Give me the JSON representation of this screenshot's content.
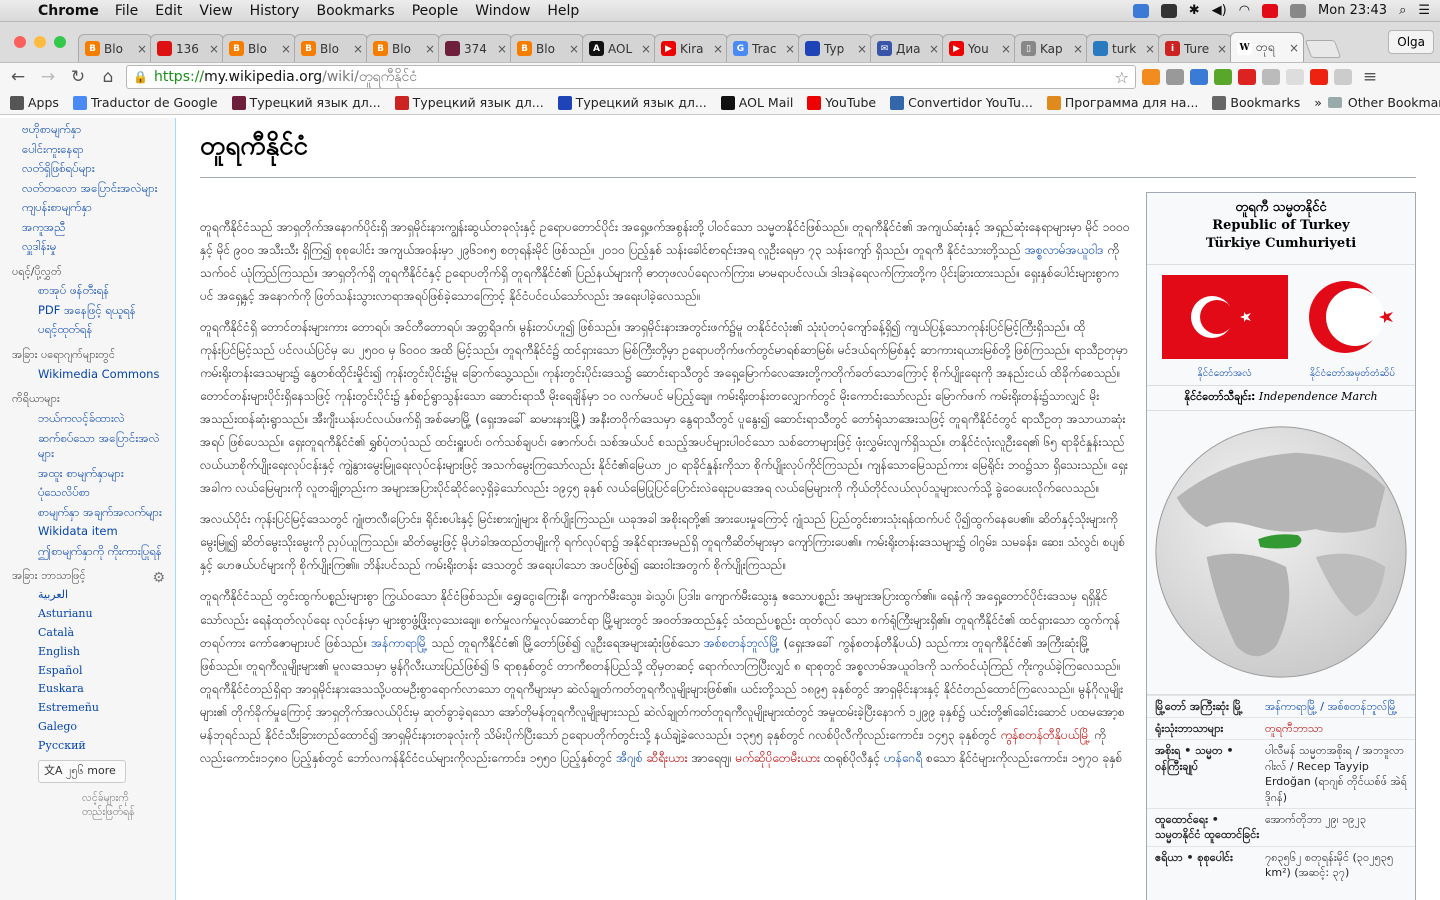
{
  "menubar": {
    "app": "Chrome",
    "items": [
      "File",
      "Edit",
      "View",
      "History",
      "Bookmarks",
      "People",
      "Window",
      "Help"
    ],
    "clock": "Mon 23:43"
  },
  "tabs": [
    {
      "title": "Blo",
      "color": "#f57d00",
      "glyph": "B"
    },
    {
      "title": "136",
      "color": "#d11",
      "glyph": ""
    },
    {
      "title": "Blo",
      "color": "#f57d00",
      "glyph": "B"
    },
    {
      "title": "Blo",
      "color": "#f57d00",
      "glyph": "B"
    },
    {
      "title": "Blo",
      "color": "#f57d00",
      "glyph": "B"
    },
    {
      "title": "374",
      "color": "#6d1f3b",
      "glyph": ""
    },
    {
      "title": "Blo",
      "color": "#f57d00",
      "glyph": "B"
    },
    {
      "title": "AOL",
      "color": "#111",
      "glyph": "A"
    },
    {
      "title": "Kira",
      "color": "#e00",
      "glyph": "▶"
    },
    {
      "title": "Trac",
      "color": "#4a8af4",
      "glyph": "G"
    },
    {
      "title": "Typ",
      "color": "#1e44b8",
      "glyph": ""
    },
    {
      "title": "Диа",
      "color": "#3a55a8",
      "glyph": "✉"
    },
    {
      "title": "You",
      "color": "#e00",
      "glyph": "▶"
    },
    {
      "title": "Kap",
      "color": "#888",
      "glyph": "▯"
    },
    {
      "title": "turk",
      "color": "#2a7ac0",
      "glyph": ""
    },
    {
      "title": "Ture",
      "color": "#c22",
      "glyph": "i"
    },
    {
      "title": "တုရ",
      "color": "#fff",
      "glyph": "W"
    }
  ],
  "profile_name": "Olga",
  "address": {
    "scheme": "https://",
    "host": "my.wikipedia.org",
    "path": "/wiki/တူရကီနိုင်ငံ"
  },
  "bookmarks": [
    {
      "label": "Apps",
      "color": "#555"
    },
    {
      "label": "Traductor de Google",
      "color": "#4a8af4"
    },
    {
      "label": "Турецкий язык дл...",
      "color": "#6d1f3b"
    },
    {
      "label": "Турецкий язык дл...",
      "color": "#c22"
    },
    {
      "label": "Турецкий язык дл...",
      "color": "#1e44b8"
    },
    {
      "label": "AOL Mail",
      "color": "#111"
    },
    {
      "label": "YouTube",
      "color": "#e00"
    },
    {
      "label": "Convertidor YouTu...",
      "color": "#3366aa"
    },
    {
      "label": "Программа для на...",
      "color": "#e08a1e"
    },
    {
      "label": "Bookmarks",
      "color": "#666"
    }
  ],
  "other_bookmarks": "Other Bookmarks",
  "sidebar": {
    "top_links": [
      "ဗဟိုစာမျက်နှာ",
      "ပေါင်းကူးနေရာ",
      "လတ်ရှိဖြစ်ရပ်များ",
      "လတ်တလော အပြောင်းအလဲများ",
      "ကျပန်းစာမျက်နှာ",
      "အကူအညီ",
      "လှူဒါန်းမှု"
    ],
    "print_heading": "ပရင့်/ပို့လွှတ်",
    "print_links": [
      "စာအုပ် ဖန်တီးရန်",
      "PDF အနေဖြင့် ရယူရန်",
      "ပရင့်ထုတ်ရန်"
    ],
    "projects_heading": "အခြား ပရောဂျက်များတွင်",
    "projects_links": [
      "Wikimedia Commons"
    ],
    "tools_heading": "ကိရိယာများ",
    "tools_links": [
      "ဘယ်ကလင့်ခ်ထားလဲ",
      "ဆက်စပ်သော အပြောင်းအလဲများ",
      "အထူး စာမျက်နှာများ",
      "ပုံသေလိပ်စာ",
      "စာမျက်နှာ အချက်အလက်များ",
      "Wikidata item",
      "ဤစာမျက်နှာကို ကိုးကားပြုရန်"
    ],
    "lang_heading": "အခြား ဘာသာဖြင့်",
    "languages": [
      "العربية",
      "Asturianu",
      "Català",
      "English",
      "Español",
      "Euskara",
      "Estremeñu",
      "Galego",
      "Русский"
    ],
    "more_button": "၂၅၆ more",
    "edit_links": "လင့်ခ်များကို တည်းဖြတ်ရန်"
  },
  "article": {
    "title": "တူရကီနိုင်ငံ",
    "p1": "တူရကီနိုင်ငံသည် အာရှတိုက်အနောက်ပိုင်းရှိ အာရှမိုင်းနားကျွန်းဆွယ်တခုလုံးနှင့် ဥရောပတောင်ပိုင်း အရှေ့ဖက်အစွန်းတို့ ပါဝင်သော သမ္မတနိုင်ငံဖြစ်သည်။ တူရကီနိုင်ငံ၏ အကျယ်ဆုံးနှင့် အရှည်ဆုံးနေရာများမှာ မိုင် ၁၀၀၀ နှင့် မိုင် ၉၀၀ အသီးသီး ရှိကြ၍ စုစုပေါင်း အကျယ်အဝန်းမှာ ၂၉၆၁၈၅ စတုရန်းမိုင် ဖြစ်သည်။ ၂၀၁၀ ပြည့်နှစ် သန်းခေါင်စာရင်းအရ လူဦးရေမှာ ၇၃ သန်းကျော် ရှိသည်။ တူရကီ နိုင်ငံသားတို့သည်",
    "p1_link": "အစ္စလာမ်အယူဝါဒ",
    "p1_end": "ကို သက်ဝင် ယုံကြည်ကြသည်။ အာရှတိုက်ရှိ တူရကီနိုင်ငံနှင့် ဥရောပတိုက်ရှိ တူရကီနိုင်ငံ၏ ပြည်နယ်များကို ဓာတုဖလပ်ရေလက်ကြား၊ မာမရာပင်လယ်၊ ဒါးဒနဲရေလက်ကြားတို့က ပိုင်းခြားထားသည်။ ရှေးနှစ်ပေါင်းများစွာကပင် အရှေ့နှင့် အနောက်ကို ဖြတ်သန်းသွားလာရာအရပ်ဖြစ်ခဲ့သောကြောင့် နိုင်ငံပင်ငယ်သော်လည်း အရေးပါခဲ့လေသည်။",
    "p2": "တူရကီနိုင်ငံရှိ တောင်တန်းများကား တောရပ်၊ အင်တီတောရပ်၊ အတ္တရိဒက်၊ မွန်းတပ်ဟူ၍ ဖြစ်သည်။ အာရှမိုင်းနားအတွင်းဖက်၌မူ တနိုင်ငံလုံး၏ သုံးပုံတပုံကျော်ခန့်ရှိ၍ ကျယ်ပြန့်သောကုန်းပြင်မြင့်ကြီးရှိသည်။ ထိုကုန်းပြင်မြင့်သည် ပင်လယ်ပြင်မှ ပေ ၂၅၀၀ မှ ၆၀၀၀ အထိ မြင့်သည်။ တူရကီနိုင်ငံ၌ ထင်ရှားသော မြစ်ကြီးတို့မှာ ဥရောပတိုက်ဖက်တွင်မာရစ်ဆာမြစ်၊ မင်ဒယ်ရက်မြစ်နှင့် ဆာကားရယားမြစ်တို့ ဖြစ်ကြသည်။ ရာသီဥတုမှာ ကမ်းရိုးတန်းဒေသများ၌ နွေတစ်ထိုင်းမှိုင်း၍ ကုန်းတွင်းပိုင်း၌မူ ခြောက်သွေ့သည်။ ကုန်းတွင်းပိုင်းဒေသ၌ ဆောင်းရာသီတွင် အရှေ့မြောက်လေအေးတို့ကတိုက်ခတ်သောကြောင့် စိုက်ပျိုးရေးကို အနည်းငယ် ထိခိုက်စေသည်။ တောင်တန်းများပိုင်းရှိနေသဖြင့် ကုန်းတွင်းပိုင်း၌ နှစ်စဉ်ရွာသွန်းသော ဆောင်းရာသီ မိုးရေချိန်မှာ ၁၀ လက်မပင် မပြည့်ချေ။ ကမ်းရိုးတန်းတလျှောက်တွင် မိုးကောင်းသော်လည်း မြောက်ဖက် ကမ်းရိုးတန်း၌သာလျှင် မိုးအသည်းထန်ဆုံးရွာသည်။ အီးဂျီးယန်းပင်လယ်ဖက်ရှိ အစ်မောမြို့ (ရှေးအခေါ် ဆမားနားမြို့) အနီးတဝိုက်ဒေသမှာ နွေရာသီတွင် ပူနွေး၍ ဆောင်းရာသီတွင် တော်ရုံသာအေးသဖြင့် တူရကီနိုင်ငံတွင် ရာသီဥတု အသာယာဆုံးအရပ် ဖြစ်ပေသည်။ ရှေးတူရကီနိုင်ငံ၏ ရွှစ်ပုံတပုံသည် ထင်းရှူးပင်၊ ဝက်သစ်ချပင်၊ ဇောက်ပင်၊ သစ်အယ်ပင် စသည့်အပင်များပါဝင်သော သစ်တောများဖြင့် ဖုံးလွှမ်းလျက်ရှိသည်။ တနိုင်ငံလုံးလူဦးရေ၏ ၆၅ ရာခိုင်နှုန်းသည် လယ်ယာစိုက်ပျိုးရေးလုပ်ငန်းနှင့် ကျွဲနွားမွေးမြူရေးလုပ်ငန်းများဖြင့် အသက်မွေးကြသော်လည်း နိုင်ငံ၏မြေယာ ၂၀ ရာခိုင်နှုန်းကိုသာ စိုက်ပျိုးလုပ်ကိုင်ကြသည်။ ကျန်သောမြေသည်ကား မြေရိုင်း ဘဝ၌သာ ရှိသေးသည်။ ရှေးအခါက လယ်မြေများကို လူတချို့တည်းက အများအပြားပိုင်ဆိုင်လေ့ရှိခဲ့သော်လည်း ၁၉၄၅ ခုနှစ် လယ်မြေပြုပြင်ပြောင်းလဲရေးဥပဒေအရ လယ်မြေများကို ကိုယ်တိုင်လယ်လုပ်သူများလက်သို့ ခွဲဝေပေးလိုက်လေသည်။",
    "p3": "အလယ်ပိုင်း ကုန်းပြင်မြင့်ဒေသတွင် ဂျုံ၊ဗာလီ၊ပြောင်း၊ ရိုင်းစပါးနှင့် မြင်းစားဂျုံများ စိုက်ပျိုးကြသည်။ ယခုအခါ အစိုးရတို့၏ အားပေးမှုကြောင့် ဂျုံသည် ပြည်တွင်းစားသုံးရန်ထက်ပင် ပို၍ထွက်နေပေ၏။ ဆိတ်နှင့်သိုးများကို မွေးမြူ၍ ဆိတ်မွေးသိုးမွေးကို ညှပ်ယူကြသည်။ ဆိတ်မွေးဖြင့် မိုဟဲခါအထည်တမျိုးကို ရက်လုပ်ရာ၌ အနိုင်ရားအမည်ရှိ တူရကီဆိတ်များမှာ ကျော်ကြားပေ၏။ ကမ်းရိုးတန်းဒေသများ၌ ဝါဂွမ်း၊ သမခန်း၊ ဆေး၊ သံလွင်၊ စပျစ်နှင့် ဟေဇယ်ပင်များကို စိုက်ပျိုးကြ၏။ ဘိန်းပင်သည် ကမ်းရိုးတန်း ဒေသတွင် အရေးပါသော အပင်ဖြစ်၍ ဆေးဝါးအတွက် စိုက်ပျိုးကြသည်။",
    "p4": "တူရကီနိုင်ငံသည် တွင်းထွက်ပစ္စည်းများစွာ ကြွယ်ဝသော နိုင်ငံဖြစ်သည်။ ရွှေ၊ငွေ၊ကြေးနီ၊ ကျောက်မီးသွေး၊ ခဲ၊သွပ်၊ ပြဒါး၊ ကျောက်မီးသွေးနှ ဧသောပစ္စည်း အများအပြားထွက်၏။ ရေနံကို အရှေ့တောင်ပိုင်းဒေသမှ ရရှိနိုင်သော်လည်း ရေနံထုတ်လုပ်ရေး လုပ်ငန်းမှာ များစွာဖွံ့ဖြိုးလှသေးချေ။ စက်မှုလက်မှုလုပ်ဆောင်ရာ မြို့များတွင် အဝတ်အထည်နှင့် သံထည်ပစ္စည်း ထုတ်လုပ် သော စက်ရုံကြီးများရှိ၏။ တူရကီနိုင်ငံ၏ ထင်ရှားသော ထွက်ကုန်တရပ်ကား ကော်ဇောများပင် ဖြစ်သည်။",
    "p4_link1": "အန်ကာရာမြို့",
    "p4_mid": "သည် တူရကီနိုင်ငံ၏ မြို့တော်ဖြစ်၍ လူဦးရေအများဆုံးဖြစ်သော",
    "p4_link2": "အစ်စတန်ဘူလ်မြို့",
    "p4_end": "(ရှေးအခေါ် ကွန်စတန်တီနိုပယ်) သည်ကား တူရကီနိုင်ငံ၏ အကြီးဆုံးမြို့ဖြစ်သည်။ တူရကီလူမျိုးများ၏ မူလဒေသမှာ မွန်ဂိုလီးယားပြည်ဖြစ်၍ ၆ ရာစုနှစ်တွင် တာကီစတန်ပြည်သို့ ထိုမှတဆင့် ရောက်လာကြပြီးလျှင် ၈ ရာစုတွင် အစ္စလာမ်အယူဝါဒကို သက်ဝင်ယုံကြည် ကိုးကွယ်ခဲ့ကြလေသည်။ တူရကီနိုင်ငံတည်ရှိရာ အာရှမိုင်းနားဒေသသို့ပထမဦးစွာရောက်လာသော တူရကီများမှာ ဆဲလ်ချုတ်ကတ်တူရကီလူမျိုးများဖြစ်၏။ ယင်းတို့သည် ၁၈၉၅ ခုနှစ်တွင် အာရှမိုင်းနားနှင့် နိုင်ငံတည်ထောင်ကြလေသည်။ မွန်ဂိုလူမျိုးများ၏ တိုက်ခိုက်မှုကြောင့် အာရှတိုက်အလယ်ပိုင်းမှ ဆုတ်ခွာခဲ့ရသော အော်တိုမန်တူရကီလူမျိုးများသည် ဆဲလ်ချုတ်ကတ်တူရကီလူမျိုးများထံတွင် အမှုထမ်းခဲ့ပြီးနောက် ၁၂၉၉ ခုနှစ်၌ ယင်းတို့၏ခေါင်းဆောင် ပထမအော့စမန်ဘုရင်သည် နိုင်ငံသီးခြားတည်ထောင်၍ အာရှမိုင်းနားတခုလုံးကို သိမ်းပိုက်ပြီးသော် ဥရောပတိုက်တွင်းသို့ နယ်ချဲ့ခဲ့လေသည်။ ၁၃၅၅ ခုနှစ်တွင် ဂလစ်ပိုလီကိုလည်းကောင်း၊ ၁၄၅၃ ခုနှစ်တွင်",
    "p4_red1": "ကွန်စတန်တီနိုပယ်မြို့",
    "p4_tail": "ကိုလည်းကောင်း၊၁၄၈၀ ပြည့်နှစ်တွင် ဘော်လကန်နိုင်ငံငယ်များကိုလည်းကောင်း၊ ၁၅၅၀ ပြည့်နှစ်တွင်",
    "p4_link3": "အီဂျစ်",
    "p4_red2": "ဆီရီးယား",
    "p4_tail2": "အာရေဗျ၊",
    "p4_red3": "မက်ဆိုပိုတေမီးယား",
    "p4_tail3": "ထရုစ်ပိုလီနှင့်",
    "p4_link4": "ဟန်ဂေရီ",
    "p4_tail4": "စသော နိုင်ငံများကိုလည်းကောင်း၊ ၁၅၇၀ ခုနှစ်"
  },
  "infobox": {
    "title_my": "တူရကီ သမ္မတနိုင်ငံ",
    "title_en": "Republic of Turkey",
    "title_tr": "Türkiye Cumhuriyeti",
    "flag_caption": "နိုင်ငံတော်အလံ",
    "emblem_caption": "နိုင်ငံတော်အမှတ်တံဆိပ်",
    "anthem_label": "နိုင်ငံတော်သီချင်း:",
    "anthem_name": "Independence March",
    "rows": [
      {
        "k": "မြို့တော် အကြီးဆုံး မြို့",
        "v": "အန်ကာရာမြို့ / အစ်စတန်ဘူလ်မြို့",
        "style": "lnk"
      },
      {
        "k": "ရုံးသုံးဘာသာများ",
        "v": "တူရကီဘာသာ",
        "style": "red"
      },
      {
        "k": "အစိုးရ • သမ္မတ • ဝန်ကြီးချုပ်",
        "v": "ပါလီမန် သမ္မတအစိုးရ / အဘဒူလာ ဂါးလ် / Recep Tayyip Erdoğan (ရာဂျစ် တိုင်ယစ်ဖ် အဲရ်ဒိုဂန်)",
        "style": ""
      },
      {
        "k": "ထူထောင်ရေး • သမ္မတနိုင်ငံ ထူထောင်ခြင်း",
        "v": "အောက်တိုဘာ ၂၉၊ ၁၉၂၃",
        "style": ""
      },
      {
        "k": "ဧရိယာ • စုစုပေါင်း",
        "v": "၇၈၃၅၆၂ စတုရန်းမိုင် (၃၀၂၅၃၅ km²) (အဆင့်: ၃၇)",
        "style": ""
      }
    ]
  },
  "colors": {
    "flag_red": "#e30a17",
    "link": "#0645ad",
    "redlink": "#ba0000",
    "turkey_green": "#339933"
  }
}
